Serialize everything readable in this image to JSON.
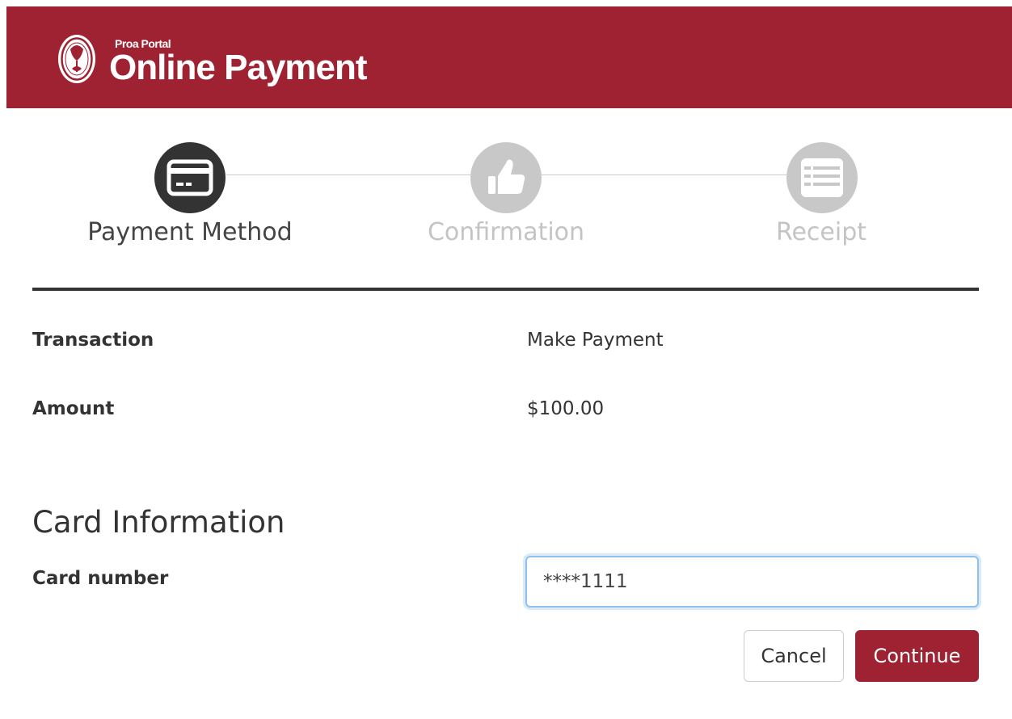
{
  "header": {
    "brand_small": "Proa Portal",
    "brand_large": "Online Payment",
    "background_color": "#9e2232",
    "logo_icon": "seal-logo-icon"
  },
  "steps": [
    {
      "label": "Payment Method",
      "icon": "credit-card-icon",
      "state": "active",
      "color": "#333333"
    },
    {
      "label": "Confirmation",
      "icon": "thumbs-up-icon",
      "state": "inactive",
      "color": "#c8c8c8"
    },
    {
      "label": "Receipt",
      "icon": "list-icon",
      "state": "inactive",
      "color": "#c8c8c8"
    }
  ],
  "details": {
    "transaction_label": "Transaction",
    "transaction_value": "Make Payment",
    "amount_label": "Amount",
    "amount_value": "$100.00"
  },
  "card_section": {
    "title": "Card Information",
    "card_number_label": "Card number",
    "card_number_value": "****1111"
  },
  "actions": {
    "cancel_label": "Cancel",
    "continue_label": "Continue",
    "primary_color": "#9e2232"
  }
}
